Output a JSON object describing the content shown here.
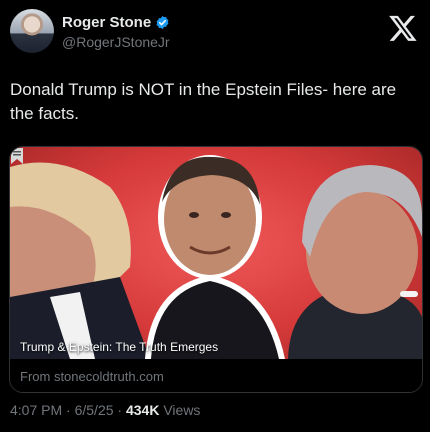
{
  "author": {
    "name": "Roger Stone",
    "handle": "@RogerJStoneJr"
  },
  "tweet": {
    "text": "Donald Trump is NOT in the Epstein Files- here are the facts."
  },
  "card": {
    "caption": "Trump & Epstein: The Truth Emerges",
    "source": "From stonecoldtruth.com"
  },
  "meta": {
    "time": "4:07 PM",
    "separator": "·",
    "date": "6/5/25",
    "views_count": "434K",
    "views_label": "Views"
  },
  "colors": {
    "background": "#000000",
    "text_primary": "#e7e9ea",
    "text_secondary": "#71767b",
    "verified_blue": "#1d9bf0",
    "card_red": "#d63a3a"
  },
  "icons": {
    "verified": "verified-badge-icon",
    "platform": "x-logo-icon",
    "bookmark": "bookmark-icon"
  }
}
